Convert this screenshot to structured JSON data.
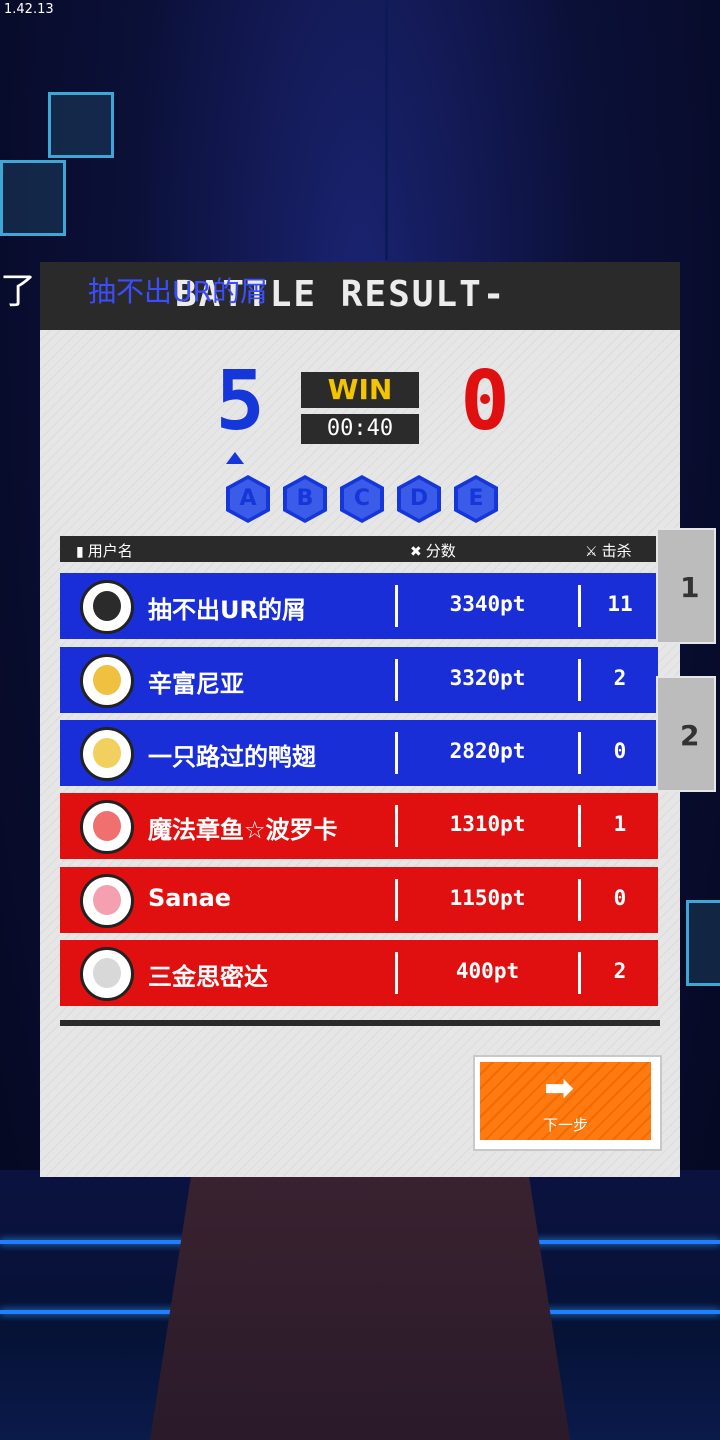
{
  "version": "1.42.13",
  "marquee": {
    "left_text": "了！",
    "name": "抽不出UR的屑"
  },
  "header": {
    "title": "BATTLE RESULT-"
  },
  "scoreboard": {
    "blue_score": "5",
    "red_score": "0",
    "result": "WIN",
    "time": "00:40",
    "zones": [
      "A",
      "B",
      "C",
      "D",
      "E"
    ]
  },
  "table": {
    "col_user": "用户名",
    "col_score": "分数",
    "col_kills": "击杀",
    "rows": [
      {
        "team": "blue",
        "name": "抽不出UR的屑",
        "score": "3340pt",
        "kills": "11"
      },
      {
        "team": "blue",
        "name": "辛富尼亚",
        "score": "3320pt",
        "kills": "2"
      },
      {
        "team": "blue",
        "name": "一只路过的鸭翅",
        "score": "2820pt",
        "kills": "0"
      },
      {
        "team": "red",
        "name": "魔法章鱼☆波罗卡",
        "score": "1310pt",
        "kills": "1"
      },
      {
        "team": "red",
        "name": "Sanae",
        "score": "1150pt",
        "kills": "0"
      },
      {
        "team": "red",
        "name": "三金思密达",
        "score": "400pt",
        "kills": "2"
      }
    ]
  },
  "next_button": {
    "label": "下一步",
    "icon": "arrow-right-icon"
  },
  "side_tabs": [
    "1",
    "2"
  ],
  "colors": {
    "blue": "#1a2ed8",
    "red": "#e01010",
    "accent": "#f26a00",
    "win": "#f5c400"
  }
}
